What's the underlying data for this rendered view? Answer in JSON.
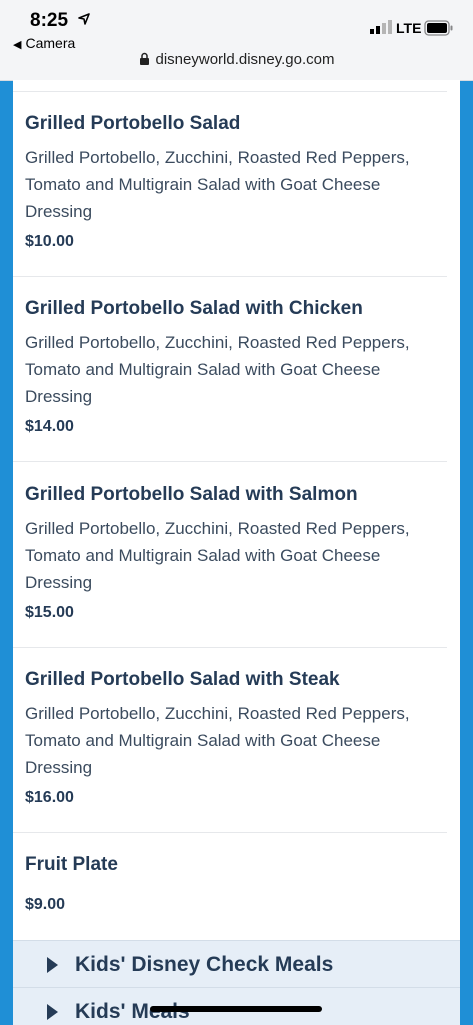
{
  "status_bar": {
    "time": "8:25",
    "back_app": "Camera",
    "url": "disneyworld.disney.go.com",
    "network": "LTE"
  },
  "menu_items": [
    {
      "name": "Grilled Portobello Salad",
      "description": "Grilled Portobello, Zucchini, Roasted Red Peppers, Tomato and Multigrain Salad with Goat Cheese Dressing",
      "price": "$10.00"
    },
    {
      "name": "Grilled Portobello Salad with Chicken",
      "description": "Grilled Portobello, Zucchini, Roasted Red Peppers, Tomato and Multigrain Salad with Goat Cheese Dressing",
      "price": "$14.00"
    },
    {
      "name": "Grilled Portobello Salad with Salmon",
      "description": "Grilled Portobello, Zucchini, Roasted Red Peppers, Tomato and Multigrain Salad with Goat Cheese Dressing",
      "price": "$15.00"
    },
    {
      "name": "Grilled Portobello Salad with Steak",
      "description": "Grilled Portobello, Zucchini, Roasted Red Peppers, Tomato and Multigrain Salad with Goat Cheese Dressing",
      "price": "$16.00"
    },
    {
      "name": "Fruit Plate",
      "price": "$9.00"
    }
  ],
  "sections": [
    {
      "label": "Kids' Disney Check Meals"
    },
    {
      "label": "Kids' Meals"
    }
  ],
  "colors": {
    "page_background": "#1f8fd6",
    "text_primary": "#253b56",
    "section_background": "#e6eef7"
  },
  "icons": [
    "location-arrow-icon",
    "back-triangle-icon",
    "lock-icon",
    "signal-icon",
    "battery-icon",
    "caret-right-icon"
  ]
}
